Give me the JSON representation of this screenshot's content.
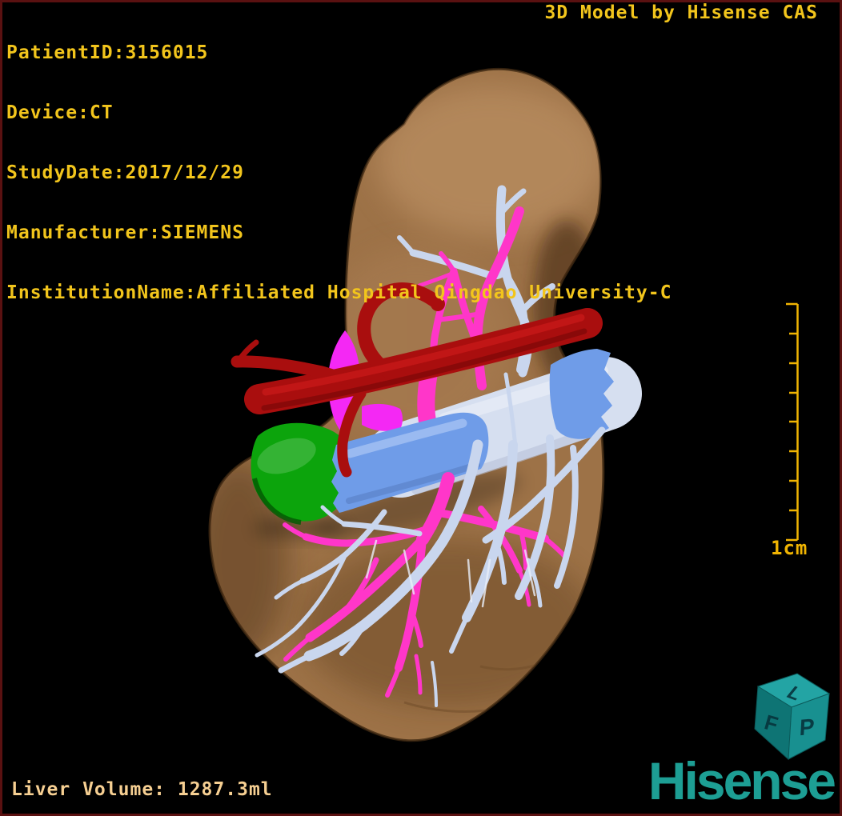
{
  "header": {
    "patient_id_line": "PatientID:3156015",
    "device_line": "Device:CT",
    "study_date_line": "StudyDate:2017/12/29",
    "manufacturer_line": "Manufacturer:SIEMENS",
    "institution_line": "InstitutionName:Affiliated Hospital Qingdao University-C"
  },
  "title": "3D Model by Hisense CAS",
  "footer": {
    "liver_volume": "Liver Volume: 1287.3ml"
  },
  "scale_bar": {
    "label": "1cm"
  },
  "orientation_cube": {
    "top_letter": "L",
    "left_letter": "F",
    "right_letter": "P"
  },
  "brand": {
    "logo_text": "Hisense"
  },
  "colors": {
    "overlay_text": "#f2c51c",
    "footer_text": "#f6cf92",
    "scale_bar": "#f0b402",
    "brand_teal": "#1d9e94",
    "cube_top": "#23a4a4",
    "cube_left": "#0e7474",
    "cube_right": "#189090",
    "cube_letter": "#07343c",
    "frame_border": "#5a1111",
    "liver": "#9d7247",
    "liver_edge": "#3f2812",
    "hepatic_artery": "#a90e0e",
    "portal_branches_pink": "#ff36c9",
    "hepatic_veins_lightblue": "#c9d6ee",
    "ivc_pale": "#d6dff0",
    "portal_vein_blue": "#6f9ce8",
    "gallbladder_green": "#0ca40c",
    "lesion_magenta": "#f428f4"
  }
}
